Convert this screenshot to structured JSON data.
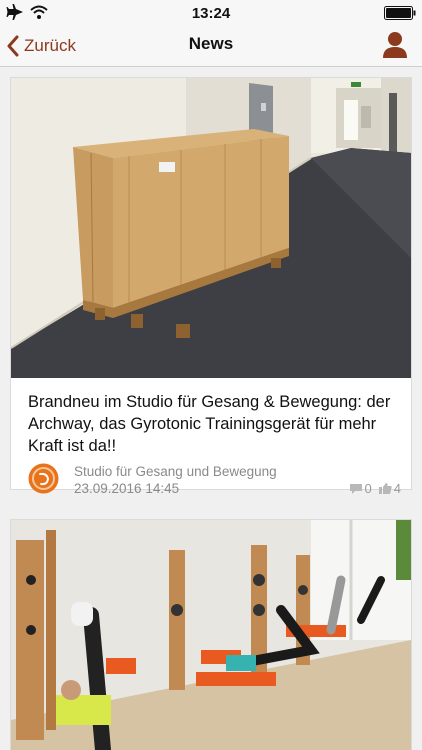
{
  "status_bar": {
    "time": "13:24",
    "icons": [
      "airplane-icon",
      "wifi-icon",
      "battery-icon"
    ]
  },
  "nav": {
    "back_label": "Zurück",
    "title": "News",
    "profile_icon": "person-icon"
  },
  "colors": {
    "accent": "#8b3a1e",
    "background": "#f0f0f0",
    "card": "#ffffff",
    "meta_text": "#8a8a8a"
  },
  "feed": {
    "items": [
      {
        "image": "wooden crate in hallway",
        "title": "Brandneu im Studio für Gesang & Bewegung: der Archway, das Gyrotonic Trainingsgerät für mehr Kraft ist da!!",
        "source": "Studio für Gesang und Bewegung",
        "date": "23.09.2016 14:45",
        "comments": "0",
        "likes": "4"
      },
      {
        "image": "people training on gyrotonic machines"
      }
    ]
  }
}
